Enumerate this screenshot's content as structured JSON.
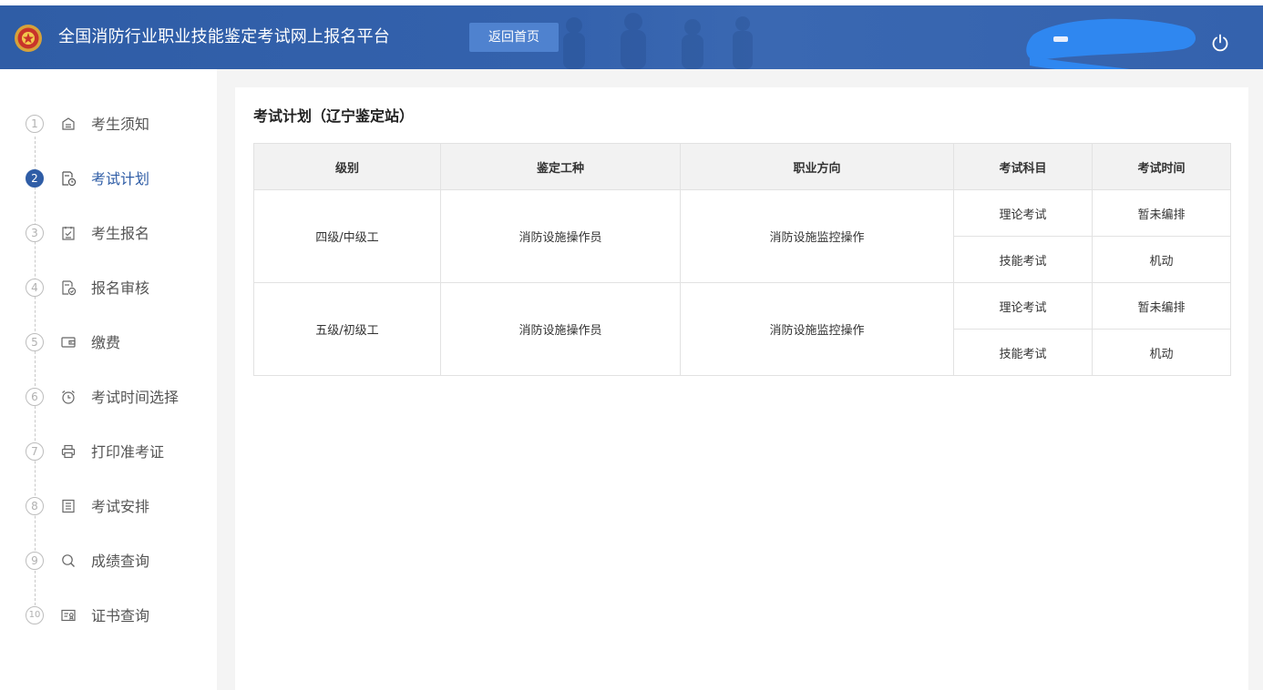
{
  "header": {
    "site_title": "全国消防行业职业技能鉴定考试网上报名平台",
    "home_button_label": "返回首页",
    "accent_color": "#2f5da6"
  },
  "sidebar": {
    "steps": [
      {
        "num": "1",
        "label": "考生须知",
        "icon": "notice-icon",
        "active": false
      },
      {
        "num": "2",
        "label": "考试计划",
        "icon": "schedule-doc-icon",
        "active": true
      },
      {
        "num": "3",
        "label": "考生报名",
        "icon": "checklist-icon",
        "active": false
      },
      {
        "num": "4",
        "label": "报名审核",
        "icon": "review-doc-icon",
        "active": false
      },
      {
        "num": "5",
        "label": "缴费",
        "icon": "wallet-icon",
        "active": false
      },
      {
        "num": "6",
        "label": "考试时间选择",
        "icon": "alarm-clock-icon",
        "active": false
      },
      {
        "num": "7",
        "label": "打印准考证",
        "icon": "printer-icon",
        "active": false
      },
      {
        "num": "8",
        "label": "考试安排",
        "icon": "list-doc-icon",
        "active": false
      },
      {
        "num": "9",
        "label": "成绩查询",
        "icon": "search-icon",
        "active": false
      },
      {
        "num": "10",
        "label": "证书查询",
        "icon": "certificate-icon",
        "active": false
      }
    ]
  },
  "main": {
    "title": "考试计划（辽宁鉴定站）",
    "table": {
      "headers": [
        "级别",
        "鉴定工种",
        "职业方向",
        "考试科目",
        "考试时间"
      ],
      "groups": [
        {
          "level": "四级/中级工",
          "occupation": "消防设施操作员",
          "direction": "消防设施监控操作",
          "subjects": [
            {
              "subject": "理论考试",
              "time": "暂未编排"
            },
            {
              "subject": "技能考试",
              "time": "机动"
            }
          ]
        },
        {
          "level": "五级/初级工",
          "occupation": "消防设施操作员",
          "direction": "消防设施监控操作",
          "subjects": [
            {
              "subject": "理论考试",
              "time": "暂未编排"
            },
            {
              "subject": "技能考试",
              "time": "机动"
            }
          ]
        }
      ]
    }
  }
}
